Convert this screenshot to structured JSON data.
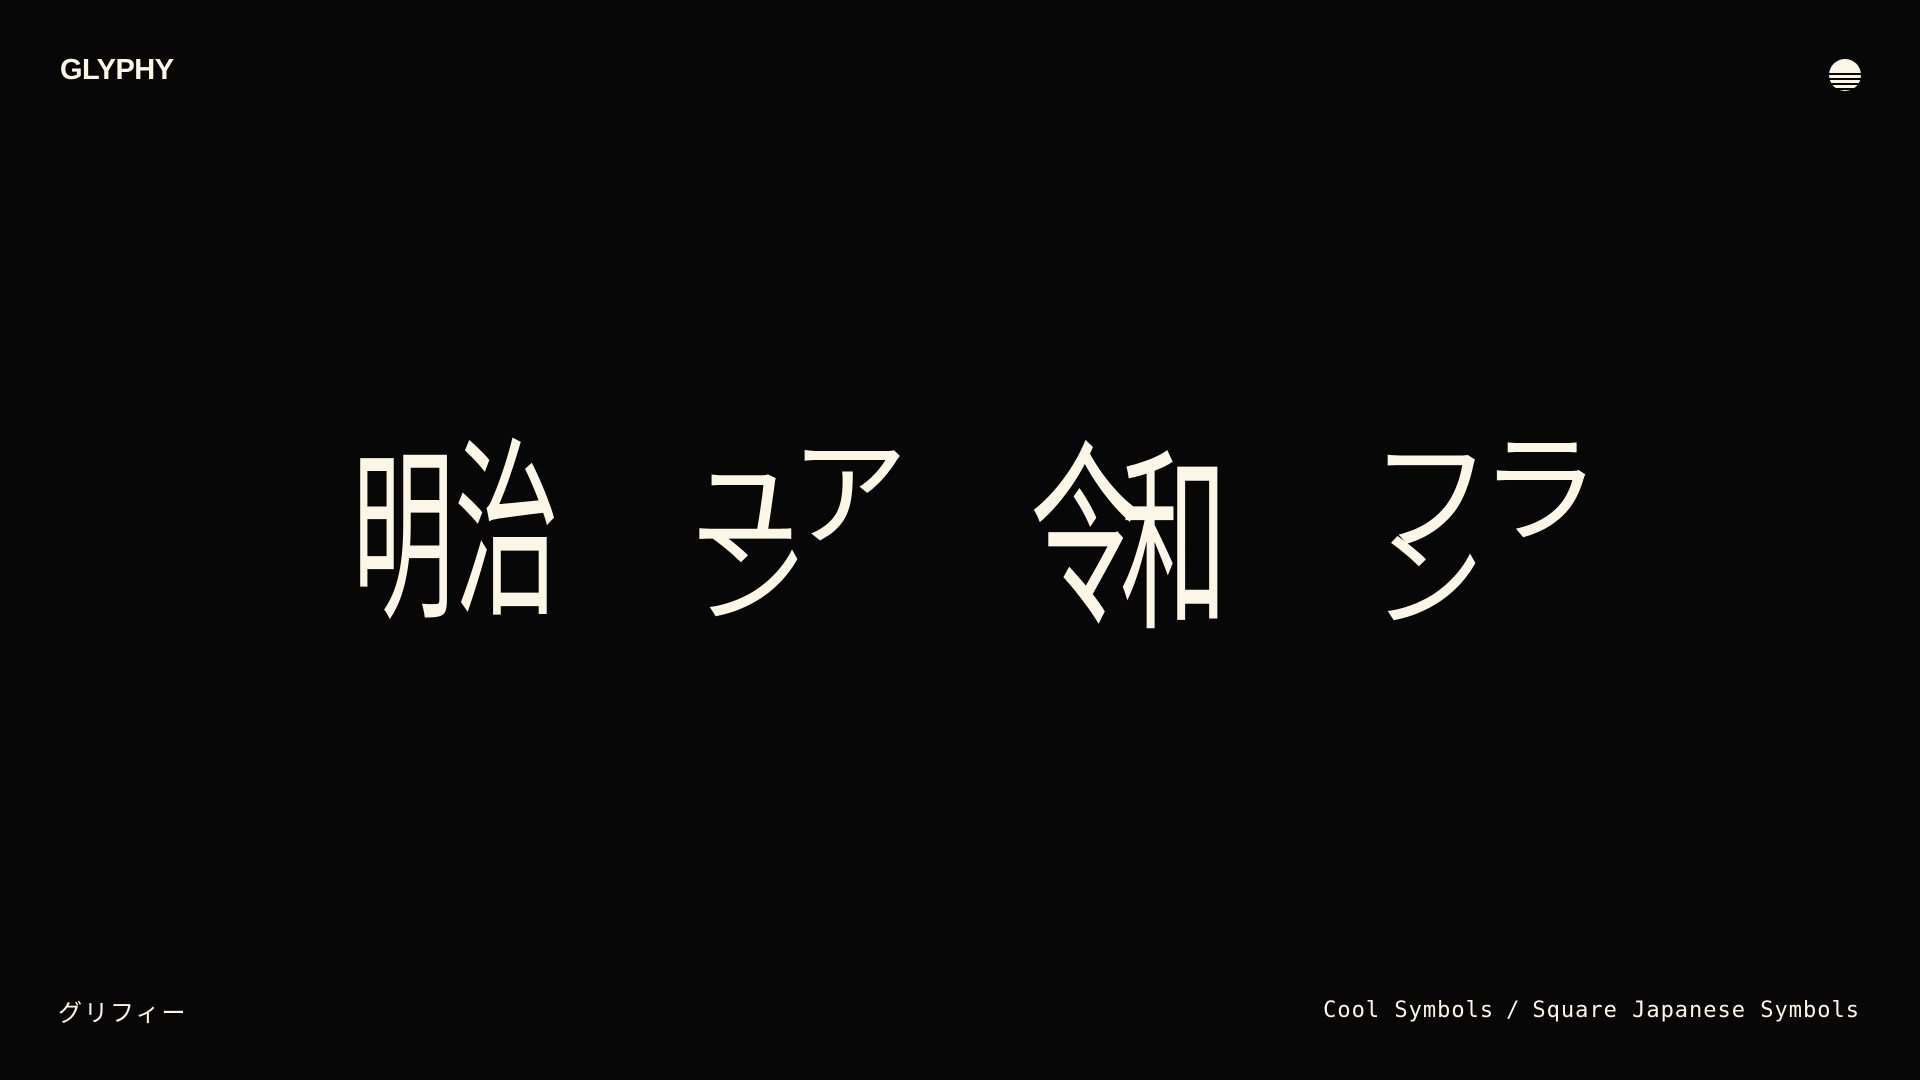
{
  "header": {
    "logo": "GLYPHY",
    "menu_icon": "striped-circle-menu-icon"
  },
  "symbols": [
    {
      "text": "明",
      "name": "symbol-mei"
    },
    {
      "text": "治",
      "name": "symbol-ji"
    },
    {
      "text": "ュ",
      "name": "symbol-small-yu"
    },
    {
      "text": "ア",
      "name": "symbol-a"
    },
    {
      "text": "ン",
      "name": "symbol-n-1"
    },
    {
      "text": "令",
      "name": "symbol-rei"
    },
    {
      "text": "和",
      "name": "symbol-wa"
    },
    {
      "text": "フ",
      "name": "symbol-fu"
    },
    {
      "text": "ラ",
      "name": "symbol-ra"
    },
    {
      "text": "ン",
      "name": "symbol-n-2"
    }
  ],
  "footer": {
    "japanese_name": "グリフィー",
    "breadcrumb": [
      "Cool Symbols",
      "Square Japanese Symbols"
    ],
    "separator": "/"
  },
  "colors": {
    "background": "#070707",
    "foreground": "#fbf6e6"
  }
}
